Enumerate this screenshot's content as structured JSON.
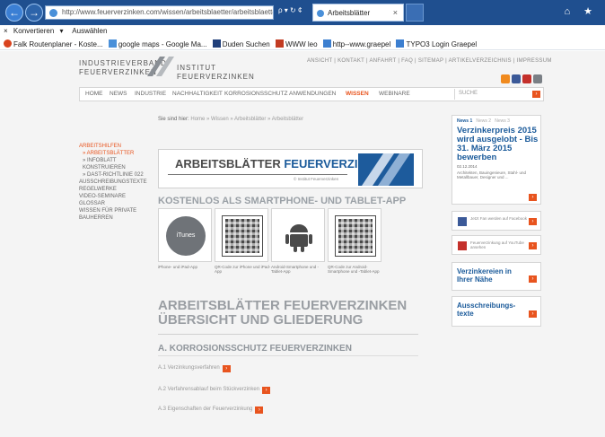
{
  "browser": {
    "url": "http://www.feuerverzinken.com/wissen/arbeitsblaetter/arbeitsblaetter/",
    "addr_tools": "ρ ▾ ↻ ¢",
    "tab_title": "Arbeitsblätter",
    "tab_close": "×"
  },
  "cmdbar": {
    "close": "×",
    "convert": "Konvertieren",
    "dropdown": "▾",
    "select": "Auswählen"
  },
  "favorites": [
    {
      "label": "Falk Routenplaner - Koste...",
      "color": "#d9441f"
    },
    {
      "label": "google maps - Google Ma...",
      "color": "#4a90d9"
    },
    {
      "label": "Duden Suchen",
      "color": "#1f3f7a"
    },
    {
      "label": "WWW leo",
      "color": "#c23b22"
    },
    {
      "label": "http--www.graepel",
      "color": "#3c7fd0"
    },
    {
      "label": "TYPO3 Login Graepel",
      "color": "#3c7fd0"
    }
  ],
  "site": {
    "logo_left": [
      "INDUSTRIEVERBAND",
      "FEUERVERZINKEN"
    ],
    "logo_right": [
      "INSTITUT",
      "FEUERVERZINKEN"
    ],
    "utility": "ANSICHT  |  KONTAKT  |  ANFAHRT  |  FAQ  |  SITEMAP  |  ARTIKELVERZEICHNIS  |  IMPRESSUM",
    "nav": [
      "HOME",
      "NEWS",
      "INDUSTRIE",
      "NACHHALTIGKEIT",
      "KORROSIONSSCHUTZ",
      "ANWENDUNGEN",
      "WISSEN",
      "WEBINARE"
    ],
    "active_nav": "WISSEN",
    "search_placeholder": "SUCHE"
  },
  "breadcrumb": {
    "prefix": "Sie sind hier:",
    "path": "Home » Wissen » Arbeitsblätter » Arbeitsblätter"
  },
  "leftnav": {
    "section": "ARBEITSHILFEN",
    "active": "» ARBEITSBLÄTTER",
    "sub1": "» INFOBLATT KONSTRUIEREN",
    "sub2": "» DAST-RICHTLINIE 022",
    "others": [
      "AUSSCHREIBUNGSTEXTE",
      "REGELWERKE",
      "VIDEO-SEMINARE",
      "GLOSSAR",
      "WISSEN FÜR PRIVATE BAUHERREN"
    ]
  },
  "banner": {
    "title_main": "ARBEITSBLÄTTER ",
    "title_accent": "FEUERVERZINKEN",
    "sub": "© Institut Feuerverzinken"
  },
  "apps": {
    "heading": "KOSTENLOS ALS SMARTPHONE- UND TABLET-APP",
    "itunes": "iTunes",
    "captions": [
      "iPhone- und iPad-App",
      "QR-Code zur iPhone und iPad-App",
      "Android-Smartphone und -Tablet-App",
      "QR-Code zur Android-Smartphone und -Tablet-App"
    ]
  },
  "overview": {
    "title1": "ARBEITSBLÄTTER FEUERVERZINKEN",
    "title2": "ÜBERSICHT UND GLIEDERUNG",
    "section": "A. KORROSIONSSCHUTZ FEUERVERZINKEN",
    "links": [
      "A.1 Verzinkungsverfahren",
      "A.2 Verfahrensablauf beim Stückverzinken",
      "A.3 Eigenschaften der Feuerverzinkung"
    ]
  },
  "sidebar": {
    "news_tabs": [
      "News 1",
      "News 2",
      "News 3"
    ],
    "news_headline": "Verzinkerpreis 2015 wird ausgelobt - Bis 31. März 2015 bewerben",
    "news_date": "02.12.2014",
    "news_text": "Architekten, Bauingenieure, Stahl- und Metallbauer, Designer und ...",
    "facebook": "Jetzt Fan werden auf Facebook",
    "youtube": "Feuerverzinkung auf YouTube ansehen",
    "link1": "Verzinkereien in Ihrer Nähe",
    "link2": "Ausschreibungs-texte"
  },
  "icons": {
    "arrow": "›",
    "back": "←",
    "forward": "→",
    "window": "⌂ ★"
  },
  "colors": {
    "accent": "#e8541e",
    "brand_blue": "#1a5a9a",
    "chrome": "#1f4f8f"
  }
}
